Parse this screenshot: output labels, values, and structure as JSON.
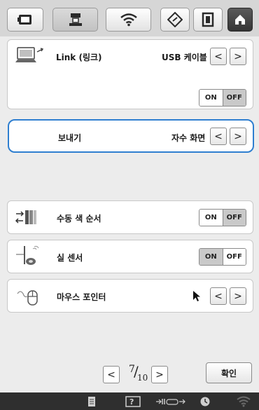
{
  "tabs": [
    {
      "name": "machine-settings-tab",
      "icon": "screen-icon"
    },
    {
      "name": "embroidery-settings-tab",
      "icon": "embroidery-machine-icon"
    },
    {
      "name": "wireless-settings-tab",
      "icon": "wifi-icon"
    },
    {
      "name": "general-settings-tab",
      "icon": "diamond-settings-icon"
    },
    {
      "name": "frame-settings-tab",
      "icon": "frame-icon"
    },
    {
      "name": "home-tab",
      "icon": "home-icon",
      "active": true
    }
  ],
  "link_row": {
    "label": "Link (링크)",
    "value": "USB 케이블",
    "toggle_on": "ON",
    "toggle_off": "OFF",
    "toggle_selected": "OFF"
  },
  "send_row": {
    "label": "보내기",
    "value": "자수 화면"
  },
  "manual_color_row": {
    "label": "수동 색 순서",
    "toggle_on": "ON",
    "toggle_off": "OFF",
    "toggle_selected": "OFF"
  },
  "thread_sensor_row": {
    "label": "실 센서",
    "toggle_on": "ON",
    "toggle_off": "OFF",
    "toggle_selected": "ON"
  },
  "mouse_pointer_row": {
    "label": "마우스 포인터",
    "value_icon": "arrow-pointer-icon"
  },
  "pager": {
    "current": "7",
    "total": "10",
    "prev": "<",
    "next": ">"
  },
  "ok_button": "확인",
  "status_bar": [
    "document-icon",
    "help-icon",
    "presser-foot-icon",
    "clock-icon",
    "wifi-icon"
  ],
  "colors": {
    "highlight_border": "#2f7fd0",
    "active_tab": "#3a3a3a",
    "status_bar": "#2f2f2f"
  }
}
